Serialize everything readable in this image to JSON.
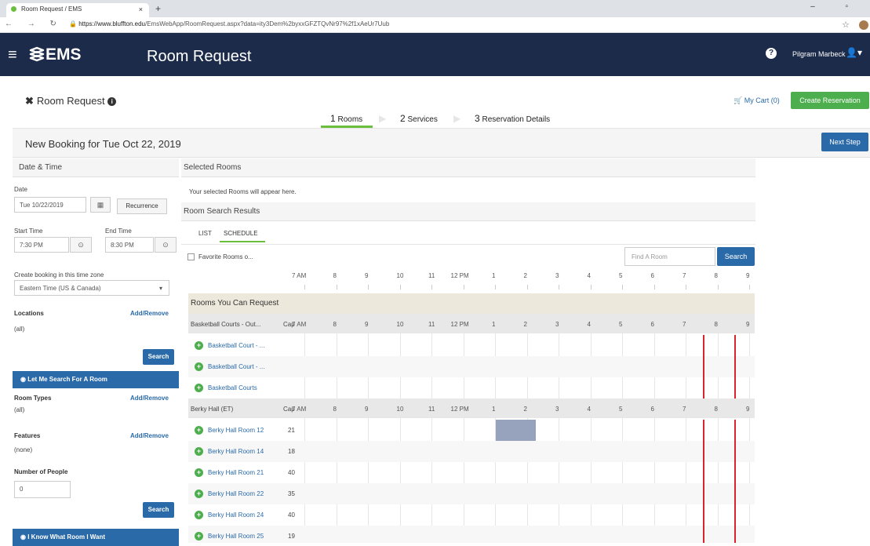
{
  "browser": {
    "tab_title": "Room Request / EMS",
    "tab_close": "×",
    "new_tab": "+",
    "url_domain": "https://www.bluffton.edu",
    "url_path": "/EmsWebApp/RoomRequest.aspx?data=ity3Dem%2byxxGFZTQvNr97%2f1xAeUr7Uub"
  },
  "header": {
    "menu_glyph": "≡",
    "logo": "EMS",
    "title": "Room Request",
    "help_glyph": "?",
    "user_name": "Pilgram Marbeck"
  },
  "page": {
    "title": "Room Request",
    "cart": "My Cart (0)",
    "create_reservation": "Create Reservation",
    "steps": [
      {
        "num": "1",
        "label": "Rooms"
      },
      {
        "num": "2",
        "label": "Services"
      },
      {
        "num": "3",
        "label": "Reservation Details"
      }
    ],
    "booking_title": "New Booking for Tue Oct 22, 2019",
    "next_step": "Next Step"
  },
  "sidebar": {
    "date_time_header": "Date & Time",
    "date_label": "Date",
    "date_value": "Tue 10/22/2019",
    "recurrence": "Recurrence",
    "start_label": "Start Time",
    "start_value": "7:30 PM",
    "end_label": "End Time",
    "end_value": "8:30 PM",
    "tz_label": "Create booking in this time zone",
    "tz_value": "Eastern Time (US & Canada)",
    "locations_label": "Locations",
    "locations_value": "(all)",
    "add_remove": "Add/Remove",
    "search": "Search",
    "let_me_search": "Let Me Search For A Room",
    "room_types_label": "Room Types",
    "room_types_value": "(all)",
    "features_label": "Features",
    "features_value": "(none)",
    "people_label": "Number of People",
    "people_value": "0",
    "know_room": "I Know What Room I Want"
  },
  "main": {
    "selected_rooms": "Selected Rooms",
    "selected_msg": "Your selected Rooms will appear here.",
    "search_results": "Room Search Results",
    "tab_list": "LIST",
    "tab_schedule": "SCHEDULE",
    "favorite_rooms": "Favorite Rooms o...",
    "find_room_placeholder": "Find A Room",
    "search": "Search",
    "hours": [
      "7 AM",
      "8",
      "9",
      "10",
      "11",
      "12 PM",
      "1",
      "2",
      "3",
      "4",
      "5",
      "6",
      "7",
      "8",
      "9"
    ],
    "group_hours": [
      "7 AM",
      "8",
      "9",
      "10",
      "11",
      "12 PM",
      "1",
      "2",
      "3",
      "4",
      "5",
      "6",
      "7",
      "8",
      "9"
    ],
    "rooms_you_can_request": "Rooms You Can Request",
    "cap_label": "Cap",
    "groups": [
      {
        "name": "Basketball Courts - Out...",
        "rooms": [
          {
            "name": "Basketball Court - ...",
            "cap": ""
          },
          {
            "name": "Basketball Court - ...",
            "cap": ""
          },
          {
            "name": "Basketball Courts",
            "cap": ""
          }
        ]
      },
      {
        "name": "Berky Hall (ET)",
        "rooms": [
          {
            "name": "Berky Hall Room 12",
            "cap": "21"
          },
          {
            "name": "Berky Hall Room 14",
            "cap": "18"
          },
          {
            "name": "Berky Hall Room 21",
            "cap": "40"
          },
          {
            "name": "Berky Hall Room 22",
            "cap": "35"
          },
          {
            "name": "Berky Hall Room 24",
            "cap": "40"
          },
          {
            "name": "Berky Hall Room 25",
            "cap": "19"
          }
        ]
      }
    ]
  },
  "colors": {
    "header_bg": "#1c2b4a",
    "primary": "#2a6aa8",
    "success": "#4cae4c",
    "selection_line": "#d9232d",
    "booked_block": "#97a3bd"
  }
}
